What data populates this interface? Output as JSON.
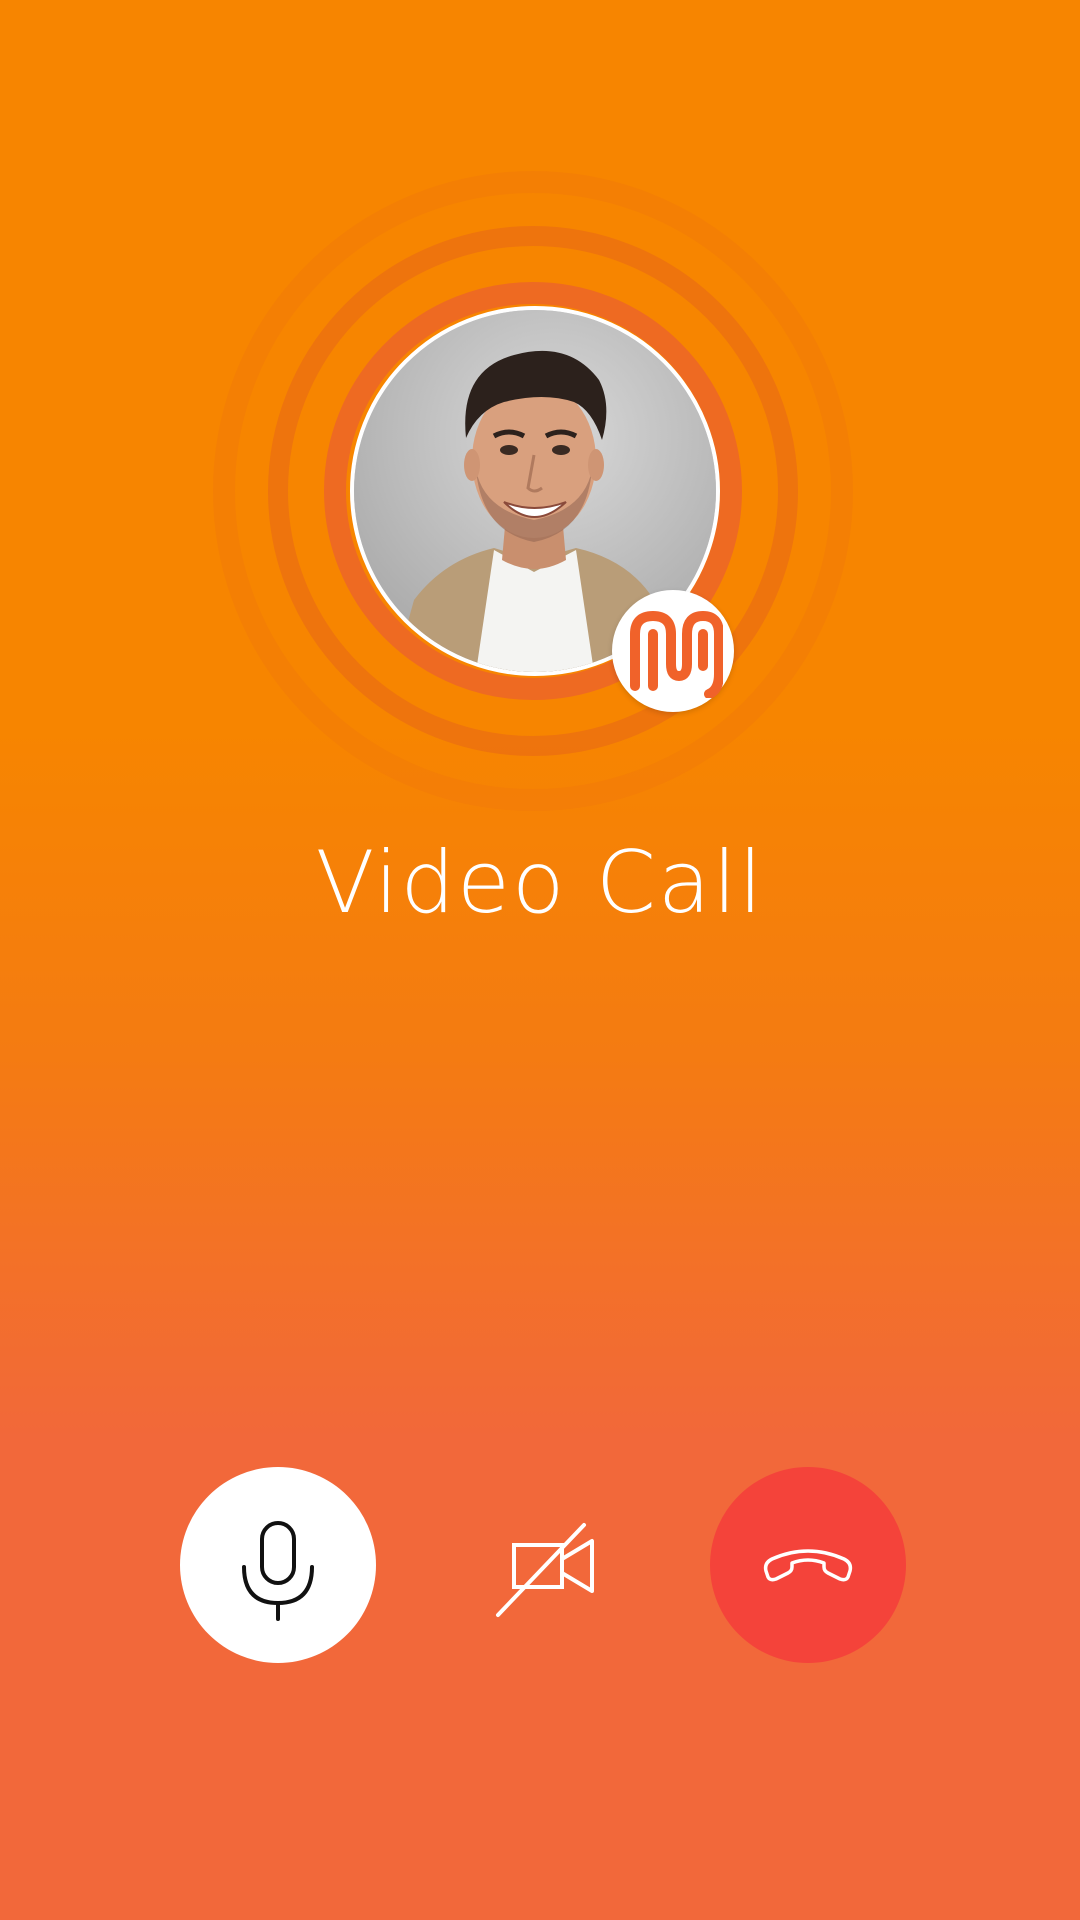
{
  "call": {
    "title": "Video Call"
  },
  "contact": {
    "avatar_icon": "contact-photo",
    "badge_icon": "app-logo-m"
  },
  "controls": [
    {
      "name": "microphone",
      "icon": "microphone-icon",
      "state": "on"
    },
    {
      "name": "camera",
      "icon": "video-off-icon",
      "state": "off"
    },
    {
      "name": "end-call",
      "icon": "hang-up-phone-icon",
      "state": "active"
    }
  ],
  "colors": {
    "background_top": "#f78500",
    "background_bottom": "#f2683a",
    "end_call": "#f4433a",
    "accent_ring": "#ee6a22",
    "text": "#ffffff"
  }
}
